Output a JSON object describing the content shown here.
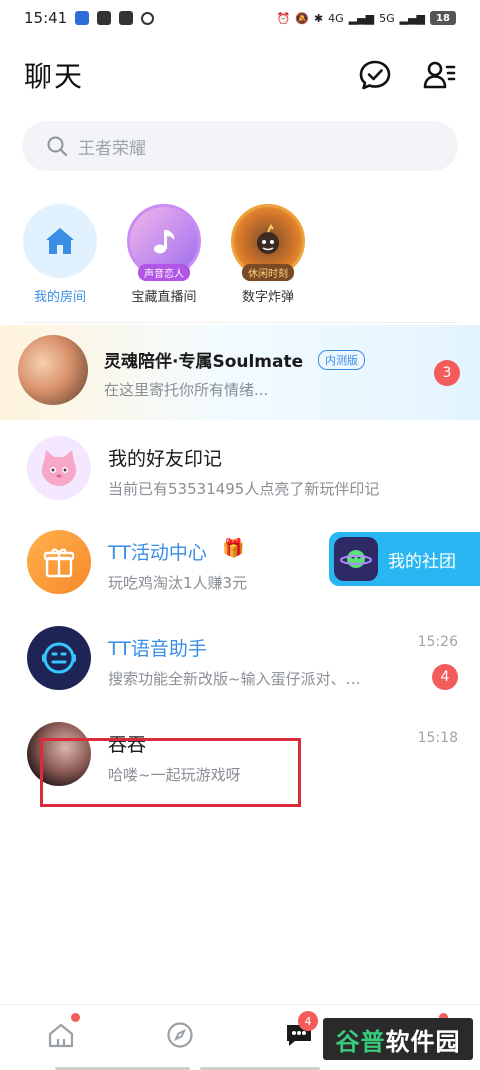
{
  "status_bar": {
    "time": "15:41",
    "network_a": "4G",
    "network_b": "5G",
    "battery": "18"
  },
  "header": {
    "title": "聊天"
  },
  "search": {
    "placeholder": "王者荣耀"
  },
  "quick_items": [
    {
      "label": "我的房间",
      "badge": ""
    },
    {
      "label": "宝藏直播间",
      "badge": "声音恋人"
    },
    {
      "label": "数字炸弹",
      "badge": "休闲时刻"
    }
  ],
  "soul_banner": {
    "title": "灵魂陪伴·专属Soulmate",
    "tag": "内测版",
    "subtitle": "在这里寄托你所有情绪...",
    "badge": "3"
  },
  "chats": [
    {
      "name": "我的好友印记",
      "message": "当前已有53531495人点亮了新玩伴印记",
      "time": "",
      "badge": ""
    },
    {
      "name": "TT活动中心",
      "message": "玩吃鸡淘汰1人赚3元",
      "time": "",
      "badge": ""
    },
    {
      "name": "TT语音助手",
      "message": "搜索功能全新改版~输入蛋仔派对、…",
      "time": "15:26",
      "badge": "4"
    },
    {
      "name": "吞吞",
      "message": "哈喽~一起玩游戏呀",
      "time": "15:18",
      "badge": ""
    }
  ],
  "club_float": {
    "label": "我的社团"
  },
  "bottom_nav": {
    "chat_badge": "4"
  },
  "watermark": {
    "part_a": "谷普",
    "part_b": "软件园"
  },
  "colors": {
    "accent": "#3a8ee6",
    "badge_red": "#f45b5b",
    "club_blue": "#29b6f2",
    "highlight_red": "#d92b3a"
  }
}
